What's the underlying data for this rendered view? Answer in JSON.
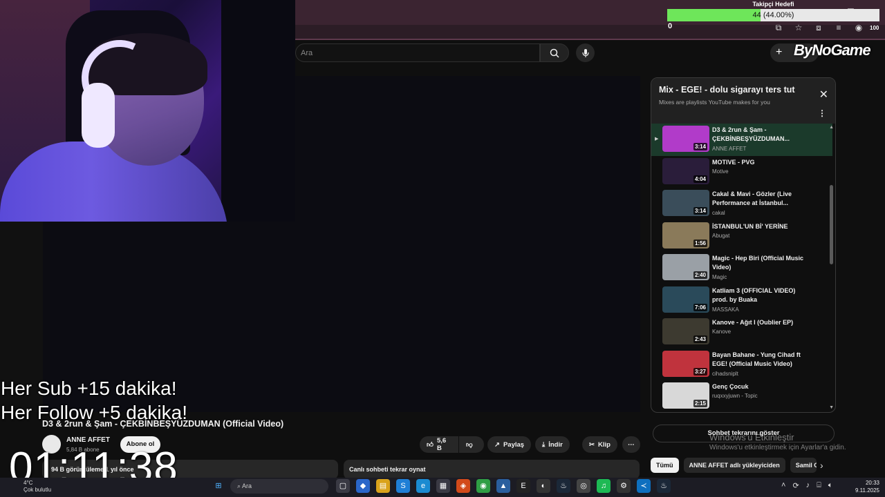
{
  "browser": {
    "icons": [
      "cast-icon",
      "star-icon",
      "extensions-icon",
      "playlist-icon",
      "profile-icon"
    ],
    "zoom_badge": "100"
  },
  "youtube_header": {
    "search_placeholder": "Ara",
    "create_label": "+"
  },
  "mix": {
    "title": "Mix - EGE! - dolu sigarayı ters tut",
    "subtitle": "Mixes are playlists YouTube makes for you",
    "items": [
      {
        "title": "D3 & 2run & Şam - ÇEKBİNBEŞYÜZDUMAN...",
        "channel": "ANNE AFFET",
        "duration": "3:14",
        "active": true,
        "thumb": "#b13bc9"
      },
      {
        "title": "MOTIVE - PVG",
        "channel": "Motive",
        "duration": "4:04",
        "active": false,
        "thumb": "#2a1d3a"
      },
      {
        "title": "Cakal & Mavi - Gözler (Live Performance at İstanbul...",
        "channel": "cakal",
        "duration": "3:14",
        "active": false,
        "thumb": "#3a4d5a"
      },
      {
        "title": "İSTANBUL'UN Bİ' YERİNE",
        "channel": "Abugat",
        "duration": "1:56",
        "active": false,
        "thumb": "#8a7a5a"
      },
      {
        "title": "Magic - Hep Biri (Official Music Video)",
        "channel": "Magic",
        "duration": "2:40",
        "active": false,
        "thumb": "#9aa0a6"
      },
      {
        "title": "Katliam 3 (OFFICIAL VIDEO) prod. by Buaka",
        "channel": "MASSAKA",
        "duration": "7:06",
        "active": false,
        "thumb": "#2a4a5a"
      },
      {
        "title": "Kanove - Ağıt I (Oublier EP)",
        "channel": "Kanove",
        "duration": "2:43",
        "active": false,
        "thumb": "#3d3a30"
      },
      {
        "title": "Bayan Bahane - Yung Cihad ft EGE! (Official Music Video)",
        "channel": "cihadsniplt",
        "duration": "3:27",
        "active": false,
        "thumb": "#c0333d"
      },
      {
        "title": "Genç Çocuk",
        "channel": "ruqxxyjuwn - Topic",
        "duration": "2:15",
        "active": false,
        "thumb": "#d8d8d8"
      }
    ]
  },
  "video": {
    "title": "D3 & 2run & Şam - ÇEKBİNBEŞYÜZDUMAN (Official Video)",
    "channel": "ANNE AFFET",
    "subscribers": "5,84 B abone",
    "subscribe_label": "Abone ol",
    "likes": "5,6 B",
    "share_label": "Paylaş",
    "download_label": "İndir",
    "clip_label": "Klip",
    "description_meta": "94 B görüntüleme  1 yıl önce",
    "replay_chat_label": "Canlı sohbeti tekrar oynat",
    "show_chat_label": "Sohbet tekrarını göster"
  },
  "chips": [
    {
      "label": "Tümü",
      "selected": true
    },
    {
      "label": "ANNE AFFET adlı yükleyiciden",
      "selected": false
    },
    {
      "label": "Samil C",
      "selected": false
    }
  ],
  "activation": {
    "line1": "Windows'u Etkinleştir",
    "line2": "Windows'u etkinleştirmek için Ayarlar'a gidin."
  },
  "overlay": {
    "goal_title": "Takipçi Hedefi",
    "goal_text": "44 (44.00%)",
    "goal_percent": 44,
    "goal_start": "0",
    "brand": "ByNoGame",
    "line1": "Her Sub +15 dakika!",
    "line2": "Her Follow +5 dakika!",
    "timer": "01:11:38"
  },
  "taskbar": {
    "weather_temp": "4°C",
    "weather_desc": "Çok bulutlu",
    "search_placeholder": "Ara",
    "time": "20:33",
    "date": "9.11.2025"
  }
}
